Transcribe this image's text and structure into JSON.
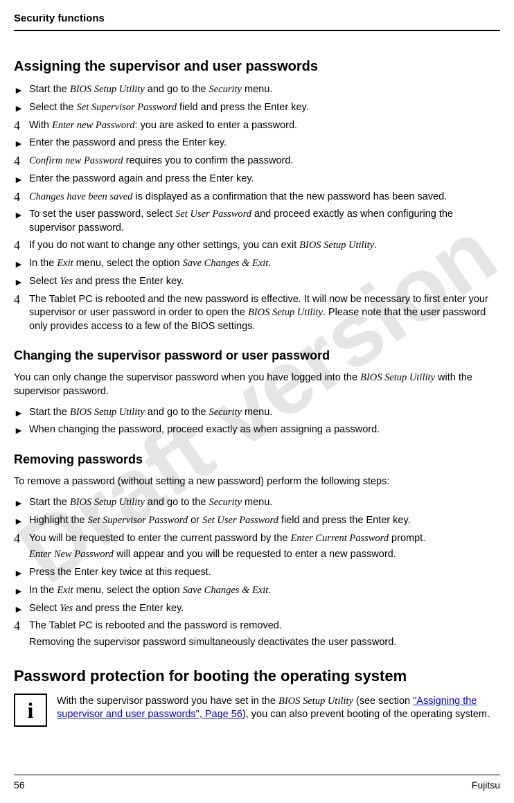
{
  "header": "Security functions",
  "watermark": "Draft version",
  "section1": {
    "title": "Assigning the supervisor and user passwords",
    "items": [
      {
        "b": "►",
        "pre": "Start the ",
        "it1": "BIOS Setup Utility",
        "mid": " and go to the ",
        "it2": "Security",
        "post": " menu."
      },
      {
        "b": "►",
        "pre": "Select the ",
        "it1": "Set Supervisor Password",
        "post": " field and press the Enter key."
      },
      {
        "b": "4",
        "pre": "With ",
        "it1": "Enter new Password",
        "post": ":  you are asked to enter a password."
      },
      {
        "b": "►",
        "pre": "Enter the password and press the Enter key."
      },
      {
        "b": "4",
        "it1": "Confirm new Password",
        "post": " requires you to confirm the password."
      },
      {
        "b": "►",
        "pre": "Enter the password again and press the Enter key."
      },
      {
        "b": "4",
        "it1": "Changes have been saved",
        "post": " is displayed as a confirmation that the new password has been saved."
      },
      {
        "b": "►",
        "pre": "To set the user password, select ",
        "it1": "Set User Password",
        "post": " and proceed exactly as when configuring the supervisor password."
      },
      {
        "b": "4",
        "pre": "If you do not want to change any other settings, you can exit ",
        "it1": "BIOS Setup Utility",
        "post": "."
      },
      {
        "b": "►",
        "pre": "In the ",
        "it1": "Exit",
        "mid": " menu, select the option ",
        "it2": "Save Changes & Exit",
        "post": "."
      },
      {
        "b": "►",
        "pre": "Select ",
        "it1": "Yes",
        "post": " and press the Enter key."
      },
      {
        "b": "4",
        "pre": "The Tablet PC is rebooted and the new password is effective. It will now be necessary to first enter your supervisor or user password in order to open the ",
        "it1": "BIOS Setup Utility",
        "post": ". Please note that the user password only provides access to a few of the BIOS settings."
      }
    ]
  },
  "section2": {
    "title": "Changing the supervisor password or user password",
    "intro_pre": "You can only change the supervisor password when you have logged into the ",
    "intro_it": "BIOS Setup Utility",
    "intro_post": " with the supervisor password.",
    "items": [
      {
        "b": "►",
        "pre": "Start the ",
        "it1": "BIOS Setup Utility",
        "mid": " and go to the ",
        "it2": "Security",
        "post": " menu."
      },
      {
        "b": "►",
        "pre": "When changing the password, proceed exactly as when assigning a password."
      }
    ]
  },
  "section3": {
    "title": "Removing passwords",
    "intro": "To remove a password (without setting a new password) perform the following steps:",
    "items": [
      {
        "b": "►",
        "pre": "Start the ",
        "it1": "BIOS Setup Utility",
        "mid": " and go to the ",
        "it2": "Security",
        "post": " menu."
      },
      {
        "b": "►",
        "pre": "Highlight the ",
        "it1": "Set Supervisor Password",
        "mid": " or ",
        "it2": "Set User Password",
        "post": " field and press the Enter key."
      },
      {
        "b": "4",
        "pre": "You will be requested to enter the current password by the ",
        "it1": "Enter Current Password",
        "post": " prompt.",
        "sub_it": "Enter New Password",
        "sub_post": " will appear and you will be requested to enter a new password."
      },
      {
        "b": "►",
        "pre": "Press the Enter key twice at this request."
      },
      {
        "b": "►",
        "pre": "In the ",
        "it1": "Exit",
        "mid": " menu, select the option ",
        "it2": "Save Changes & Exit",
        "post": "."
      },
      {
        "b": "►",
        "pre": "Select ",
        "it1": "Yes",
        "post": " and press the Enter key."
      },
      {
        "b": "4",
        "pre": "The Tablet PC is rebooted and the password is removed.",
        "sub": "Removing the supervisor password simultaneously deactivates the user password."
      }
    ]
  },
  "section4": {
    "title": "Password protection for booting the operating system",
    "info_pre": "With the supervisor password you have set in the ",
    "info_it": "BIOS Setup Utility",
    "info_mid": " (see section ",
    "info_link": "\"Assigning the supervisor and user passwords\", Page 56",
    "info_post": "), you can also prevent booting of the operating system."
  },
  "footer": {
    "page": "56",
    "brand": "Fujitsu"
  }
}
